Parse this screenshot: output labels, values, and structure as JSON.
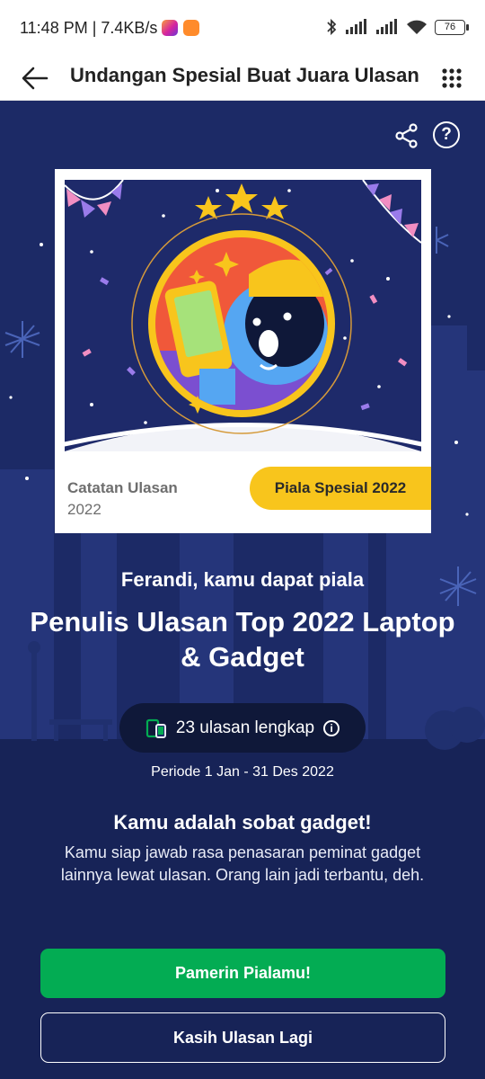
{
  "status_bar": {
    "time_network": "11:48 PM | 7.4KB/s",
    "battery": "76",
    "app_icons": [
      "instagram-icon",
      "shop-icon"
    ],
    "indicator_icons": [
      "bluetooth-icon",
      "signal-icon",
      "signal-icon",
      "wifi-icon",
      "battery-icon"
    ]
  },
  "appbar": {
    "title": "Undangan Spesial Buat Juara Ulasan",
    "back_icon": "arrow-left-icon",
    "menu_icon": "grid-dots-icon"
  },
  "actions": {
    "share_icon": "share-icon",
    "help_label": "?"
  },
  "card": {
    "record_label": "Catatan Ulasan",
    "record_year": "2022",
    "trophy_label": "Piala Spesial 2022"
  },
  "award": {
    "greeting": "Ferandi, kamu dapat piala",
    "title": "Penulis Ulasan Top 2022 Laptop & Gadget",
    "review_count": "23 ulasan lengkap",
    "info_label": "i",
    "period": "Periode 1 Jan - 31 Des 2022"
  },
  "message": {
    "heading": "Kamu adalah sobat gadget!",
    "body": "Kamu siap jawab rasa penasaran peminat gadget lainnya lewat ulasan. Orang lain jadi terbantu, deh."
  },
  "buttons": {
    "primary_label": "Pamerin Pialamu!",
    "secondary_label": "Kasih Ulasan Lagi"
  },
  "colors": {
    "background": "#1c2a66",
    "primary_button": "#03ac53",
    "trophy_badge": "#f8c51c",
    "pill": "#0f1839"
  }
}
